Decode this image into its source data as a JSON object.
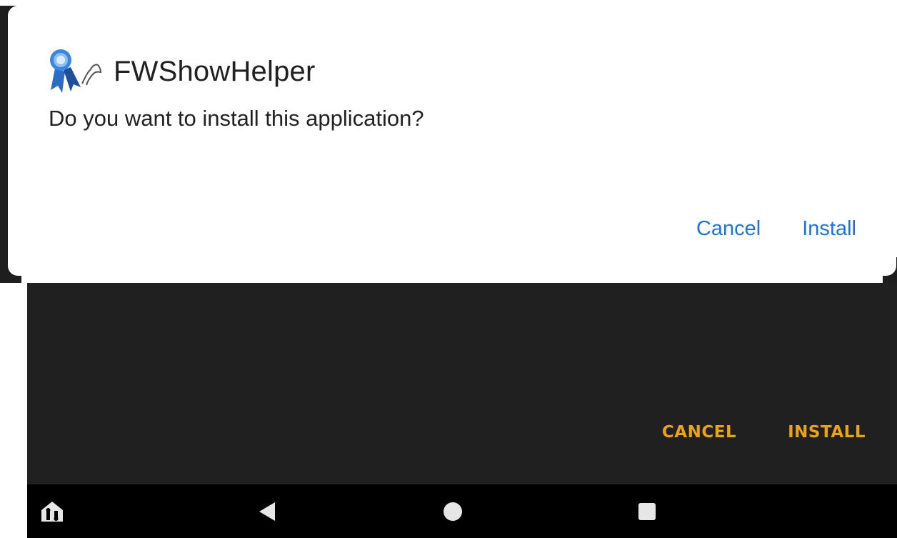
{
  "dialog": {
    "app_name": "FWShowHelper",
    "app_icon": "ribbon-horse-icon",
    "question": "Do you want to install this application?",
    "cancel_label": "Cancel",
    "install_label": "Install",
    "accent_color": "#1a73e8"
  },
  "background_dialog": {
    "cancel_label": "CANCEL",
    "install_label": "INSTALL",
    "accent_color": "#e8a317"
  },
  "navbar": {
    "items": [
      {
        "name": "home-app-icon"
      },
      {
        "name": "back-icon"
      },
      {
        "name": "home-icon"
      },
      {
        "name": "recents-icon"
      }
    ]
  }
}
